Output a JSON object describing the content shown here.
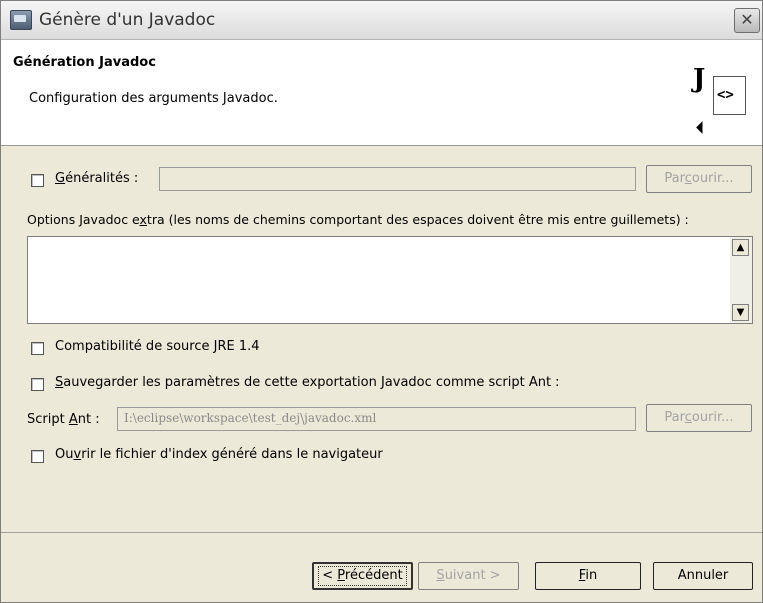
{
  "window": {
    "title": "Génère d'un Javadoc",
    "close_glyph": "✕"
  },
  "header": {
    "title": "Génération Javadoc",
    "description": "Configuration des arguments Javadoc.",
    "icon_letter": "J",
    "icon_doc_glyph": "<>"
  },
  "general": {
    "label_pre": "",
    "label_mnemonic": "G",
    "label_post": "énéralités :",
    "value": "",
    "browse_pre": "Par",
    "browse_mnemonic": "c",
    "browse_post": "ourir..."
  },
  "extra_options": {
    "label_pre": "Options Javadoc e",
    "label_mnemonic": "x",
    "label_post": "tra (les noms de chemins comportant des espaces doivent être mis entre guillemets) :",
    "value": "",
    "scroll_up": "▲",
    "scroll_down": "▼"
  },
  "jre_compat": {
    "label": "Compatibilité de source JRE 1.4"
  },
  "save_ant": {
    "label_mnemonic": "S",
    "label_post": "auvegarder les paramètres de cette exportation Javadoc comme script Ant :"
  },
  "script_ant": {
    "label_pre": "Script ",
    "label_mnemonic": "A",
    "label_post": "nt :",
    "value": "I:\\eclipse\\workspace\\test_dej\\javadoc.xml",
    "browse_pre": "Par",
    "browse_mnemonic": "c",
    "browse_post": "ourir..."
  },
  "open_index": {
    "label_pre": "Ou",
    "label_mnemonic": "v",
    "label_post": "rir le fichier d'index généré dans le navigateur"
  },
  "buttons": {
    "back_pre": "< ",
    "back_mnemonic": "P",
    "back_post": "récédent",
    "next_mnemonic": "S",
    "next_post": "uivant >",
    "finish_mnemonic": "F",
    "finish_post": "in",
    "cancel": "Annuler"
  }
}
